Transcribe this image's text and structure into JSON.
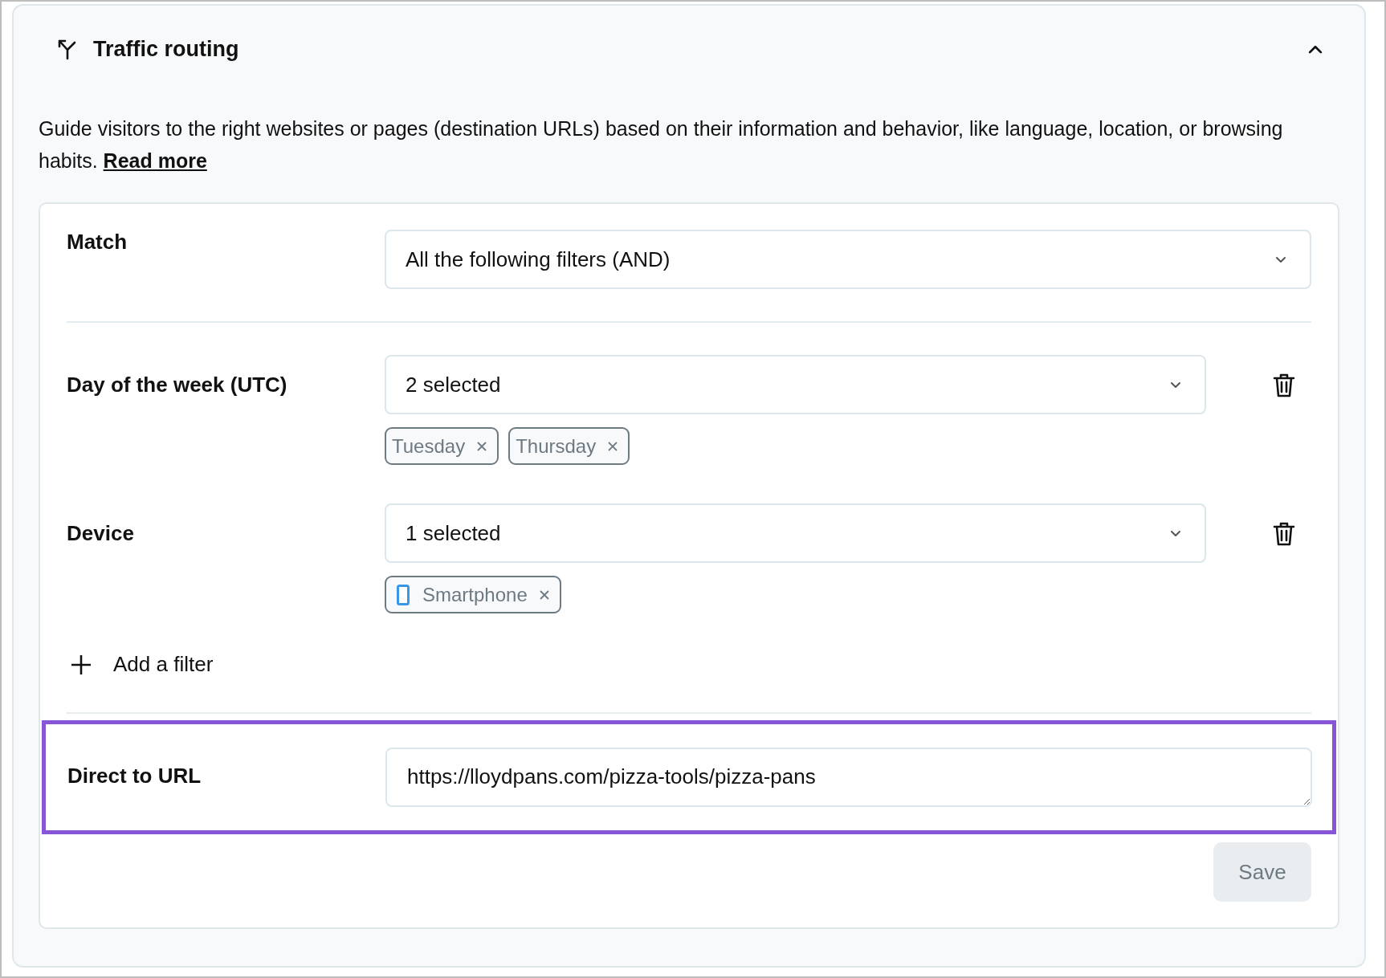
{
  "panel": {
    "title": "Traffic routing",
    "expanded": true
  },
  "description": {
    "text": "Guide visitors to the right websites or pages (destination URLs) based on their information and behavior, like language, location, or browsing habits.",
    "link": "Read more"
  },
  "match": {
    "label": "Match",
    "value": "All the following filters (AND)"
  },
  "filters": [
    {
      "label": "Day of the week (UTC)",
      "summary": "2 selected",
      "tags": [
        {
          "label": "Tuesday",
          "kind": "plain"
        },
        {
          "label": "Thursday",
          "kind": "plain"
        }
      ]
    },
    {
      "label": "Device",
      "summary": "1 selected",
      "tags": [
        {
          "label": "Smartphone",
          "kind": "smartphone"
        }
      ]
    }
  ],
  "add_filter": {
    "label": "Add a filter"
  },
  "redirect": {
    "label": "Direct to URL",
    "value": "https://lloydpans.com/pizza-tools/pizza-pans",
    "highlighted": true
  },
  "save": {
    "label": "Save",
    "disabled": true
  }
}
